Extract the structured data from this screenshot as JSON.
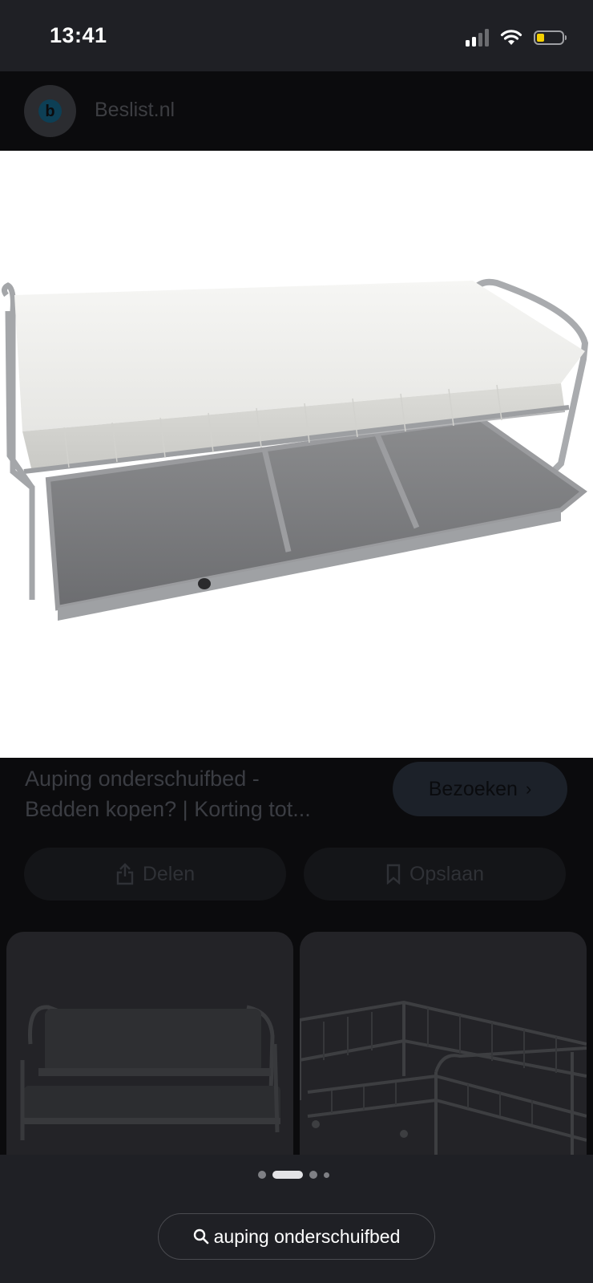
{
  "status_bar": {
    "time": "13:41"
  },
  "source": {
    "logo_letter": "b",
    "name": "Beslist.nl"
  },
  "result": {
    "title_line1": "Auping onderschuifbed -",
    "title_line2": "Bedden kopen? | Korting tot...",
    "visit_label": "Bezoeken",
    "share_label": "Delen",
    "save_label": "Opslaan"
  },
  "pager": {
    "count": 4,
    "active_index": 1
  },
  "search": {
    "query": "auping onderschuifbed"
  },
  "colors": {
    "status_bg": "#1f2025",
    "page_bg": "#0b0b0d",
    "battery_accent": "#f5d000"
  }
}
